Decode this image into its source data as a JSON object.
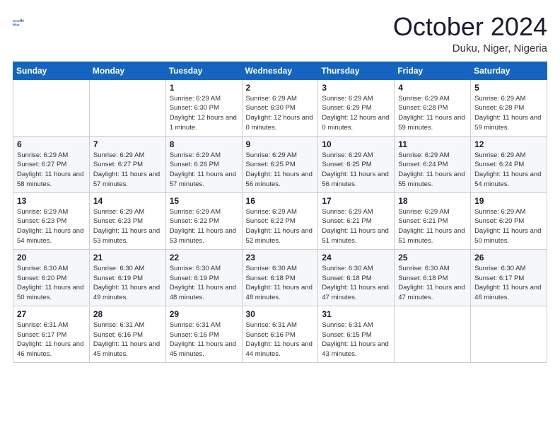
{
  "header": {
    "logo_general": "General",
    "logo_blue": "Blue",
    "month_title": "October 2024",
    "location": "Duku, Niger, Nigeria"
  },
  "weekdays": [
    "Sunday",
    "Monday",
    "Tuesday",
    "Wednesday",
    "Thursday",
    "Friday",
    "Saturday"
  ],
  "weeks": [
    [
      {
        "day": "",
        "sunrise": "",
        "sunset": "",
        "daylight": ""
      },
      {
        "day": "",
        "sunrise": "",
        "sunset": "",
        "daylight": ""
      },
      {
        "day": "1",
        "sunrise": "Sunrise: 6:29 AM",
        "sunset": "Sunset: 6:30 PM",
        "daylight": "Daylight: 12 hours and 1 minute."
      },
      {
        "day": "2",
        "sunrise": "Sunrise: 6:29 AM",
        "sunset": "Sunset: 6:30 PM",
        "daylight": "Daylight: 12 hours and 0 minutes."
      },
      {
        "day": "3",
        "sunrise": "Sunrise: 6:29 AM",
        "sunset": "Sunset: 6:29 PM",
        "daylight": "Daylight: 12 hours and 0 minutes."
      },
      {
        "day": "4",
        "sunrise": "Sunrise: 6:29 AM",
        "sunset": "Sunset: 6:28 PM",
        "daylight": "Daylight: 11 hours and 59 minutes."
      },
      {
        "day": "5",
        "sunrise": "Sunrise: 6:29 AM",
        "sunset": "Sunset: 6:28 PM",
        "daylight": "Daylight: 11 hours and 59 minutes."
      }
    ],
    [
      {
        "day": "6",
        "sunrise": "Sunrise: 6:29 AM",
        "sunset": "Sunset: 6:27 PM",
        "daylight": "Daylight: 11 hours and 58 minutes."
      },
      {
        "day": "7",
        "sunrise": "Sunrise: 6:29 AM",
        "sunset": "Sunset: 6:27 PM",
        "daylight": "Daylight: 11 hours and 57 minutes."
      },
      {
        "day": "8",
        "sunrise": "Sunrise: 6:29 AM",
        "sunset": "Sunset: 6:26 PM",
        "daylight": "Daylight: 11 hours and 57 minutes."
      },
      {
        "day": "9",
        "sunrise": "Sunrise: 6:29 AM",
        "sunset": "Sunset: 6:25 PM",
        "daylight": "Daylight: 11 hours and 56 minutes."
      },
      {
        "day": "10",
        "sunrise": "Sunrise: 6:29 AM",
        "sunset": "Sunset: 6:25 PM",
        "daylight": "Daylight: 11 hours and 56 minutes."
      },
      {
        "day": "11",
        "sunrise": "Sunrise: 6:29 AM",
        "sunset": "Sunset: 6:24 PM",
        "daylight": "Daylight: 11 hours and 55 minutes."
      },
      {
        "day": "12",
        "sunrise": "Sunrise: 6:29 AM",
        "sunset": "Sunset: 6:24 PM",
        "daylight": "Daylight: 11 hours and 54 minutes."
      }
    ],
    [
      {
        "day": "13",
        "sunrise": "Sunrise: 6:29 AM",
        "sunset": "Sunset: 6:23 PM",
        "daylight": "Daylight: 11 hours and 54 minutes."
      },
      {
        "day": "14",
        "sunrise": "Sunrise: 6:29 AM",
        "sunset": "Sunset: 6:23 PM",
        "daylight": "Daylight: 11 hours and 53 minutes."
      },
      {
        "day": "15",
        "sunrise": "Sunrise: 6:29 AM",
        "sunset": "Sunset: 6:22 PM",
        "daylight": "Daylight: 11 hours and 53 minutes."
      },
      {
        "day": "16",
        "sunrise": "Sunrise: 6:29 AM",
        "sunset": "Sunset: 6:22 PM",
        "daylight": "Daylight: 11 hours and 52 minutes."
      },
      {
        "day": "17",
        "sunrise": "Sunrise: 6:29 AM",
        "sunset": "Sunset: 6:21 PM",
        "daylight": "Daylight: 11 hours and 51 minutes."
      },
      {
        "day": "18",
        "sunrise": "Sunrise: 6:29 AM",
        "sunset": "Sunset: 6:21 PM",
        "daylight": "Daylight: 11 hours and 51 minutes."
      },
      {
        "day": "19",
        "sunrise": "Sunrise: 6:29 AM",
        "sunset": "Sunset: 6:20 PM",
        "daylight": "Daylight: 11 hours and 50 minutes."
      }
    ],
    [
      {
        "day": "20",
        "sunrise": "Sunrise: 6:30 AM",
        "sunset": "Sunset: 6:20 PM",
        "daylight": "Daylight: 11 hours and 50 minutes."
      },
      {
        "day": "21",
        "sunrise": "Sunrise: 6:30 AM",
        "sunset": "Sunset: 6:19 PM",
        "daylight": "Daylight: 11 hours and 49 minutes."
      },
      {
        "day": "22",
        "sunrise": "Sunrise: 6:30 AM",
        "sunset": "Sunset: 6:19 PM",
        "daylight": "Daylight: 11 hours and 48 minutes."
      },
      {
        "day": "23",
        "sunrise": "Sunrise: 6:30 AM",
        "sunset": "Sunset: 6:18 PM",
        "daylight": "Daylight: 11 hours and 48 minutes."
      },
      {
        "day": "24",
        "sunrise": "Sunrise: 6:30 AM",
        "sunset": "Sunset: 6:18 PM",
        "daylight": "Daylight: 11 hours and 47 minutes."
      },
      {
        "day": "25",
        "sunrise": "Sunrise: 6:30 AM",
        "sunset": "Sunset: 6:18 PM",
        "daylight": "Daylight: 11 hours and 47 minutes."
      },
      {
        "day": "26",
        "sunrise": "Sunrise: 6:30 AM",
        "sunset": "Sunset: 6:17 PM",
        "daylight": "Daylight: 11 hours and 46 minutes."
      }
    ],
    [
      {
        "day": "27",
        "sunrise": "Sunrise: 6:31 AM",
        "sunset": "Sunset: 6:17 PM",
        "daylight": "Daylight: 11 hours and 46 minutes."
      },
      {
        "day": "28",
        "sunrise": "Sunrise: 6:31 AM",
        "sunset": "Sunset: 6:16 PM",
        "daylight": "Daylight: 11 hours and 45 minutes."
      },
      {
        "day": "29",
        "sunrise": "Sunrise: 6:31 AM",
        "sunset": "Sunset: 6:16 PM",
        "daylight": "Daylight: 11 hours and 45 minutes."
      },
      {
        "day": "30",
        "sunrise": "Sunrise: 6:31 AM",
        "sunset": "Sunset: 6:16 PM",
        "daylight": "Daylight: 11 hours and 44 minutes."
      },
      {
        "day": "31",
        "sunrise": "Sunrise: 6:31 AM",
        "sunset": "Sunset: 6:15 PM",
        "daylight": "Daylight: 11 hours and 43 minutes."
      },
      {
        "day": "",
        "sunrise": "",
        "sunset": "",
        "daylight": ""
      },
      {
        "day": "",
        "sunrise": "",
        "sunset": "",
        "daylight": ""
      }
    ]
  ]
}
